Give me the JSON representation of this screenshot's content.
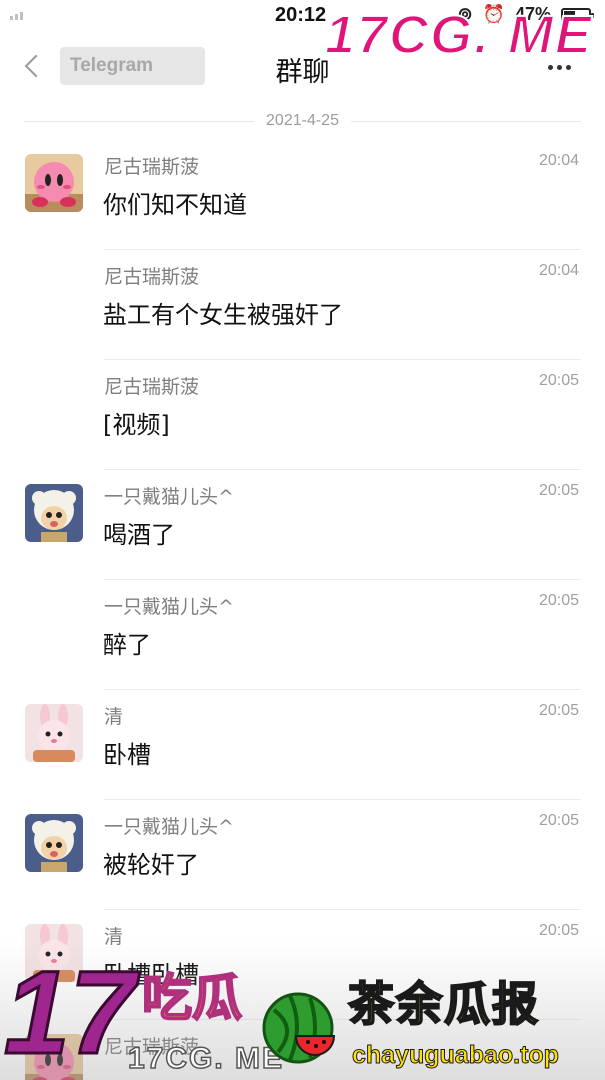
{
  "status_bar": {
    "time": "20:12",
    "battery": "47%",
    "battery_level": 0.47
  },
  "nav": {
    "back_label": "Telegram",
    "title": "群聊"
  },
  "date_divider": "2021-4-25",
  "messages": [
    {
      "sender": "尼古瑞斯菠",
      "time": "20:04",
      "text": "你们知不知道",
      "avatar": "kirby-avatar",
      "show_avatar": true
    },
    {
      "sender": "尼古瑞斯菠",
      "time": "20:04",
      "text": "盐工有个女生被强奸了",
      "avatar": "",
      "show_avatar": false
    },
    {
      "sender": "尼古瑞斯菠",
      "time": "20:05",
      "text": "[视频]",
      "avatar": "",
      "show_avatar": false
    },
    {
      "sender": "一只戴猫儿头^",
      "time": "20:05",
      "text": "喝酒了",
      "avatar": "sheep-avatar",
      "show_avatar": true
    },
    {
      "sender": "一只戴猫儿头^",
      "time": "20:05",
      "text": "醉了",
      "avatar": "",
      "show_avatar": false
    },
    {
      "sender": "清",
      "time": "20:05",
      "text": "卧槽",
      "avatar": "bunny-avatar",
      "show_avatar": true
    },
    {
      "sender": "一只戴猫儿头^",
      "time": "20:05",
      "text": "被轮奸了",
      "avatar": "sheep-avatar",
      "show_avatar": true
    },
    {
      "sender": "清",
      "time": "20:05",
      "text": "卧槽卧槽",
      "avatar": "bunny-avatar",
      "show_avatar": true
    },
    {
      "sender": "尼古瑞斯菠",
      "time": "",
      "text": "",
      "avatar": "kirby-avatar",
      "show_avatar": true
    }
  ],
  "watermarks": {
    "top": "17CG. ME",
    "bottom_number": "17",
    "bottom_chigua": "吃瓜",
    "bottom_url_left": "17CG. ME",
    "bottom_brand": "茶余瓜报",
    "bottom_url_right": "chayuguabao.top"
  },
  "colors": {
    "watermark_pink": "#e0157a",
    "watermark_purple": "#a0268f",
    "watermark_yellow": "#ffe200",
    "sender_gray": "#7f7f7f"
  }
}
